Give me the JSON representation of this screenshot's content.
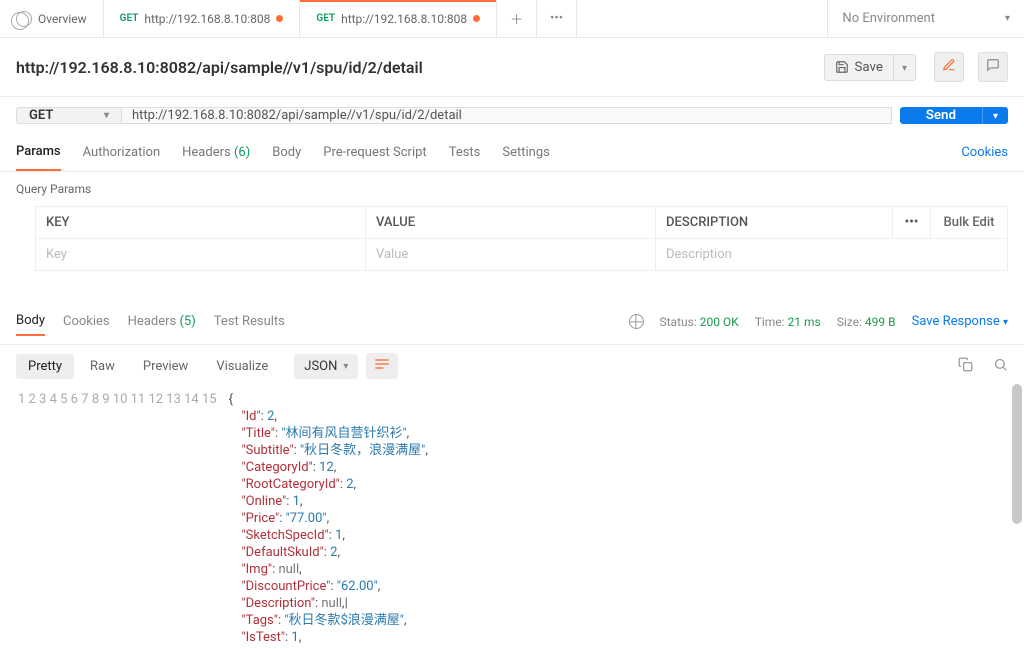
{
  "tabs": [
    {
      "kind": "overview",
      "label": "Overview"
    },
    {
      "kind": "req",
      "method": "GET",
      "label": "http://192.168.8.10:808",
      "dirty": true
    },
    {
      "kind": "req",
      "method": "GET",
      "label": "http://192.168.8.10:808",
      "dirty": true,
      "active": true
    }
  ],
  "env": {
    "label": "No Environment"
  },
  "request": {
    "title": "http://192.168.8.10:8082/api/sample//v1/spu/id/2/detail",
    "method": "GET",
    "url": "http://192.168.8.10:8082/api/sample//v1/spu/id/2/detail",
    "save": "Save",
    "send": "Send"
  },
  "reqtabs": {
    "params": "Params",
    "auth": "Authorization",
    "headers": "Headers",
    "headers_count": "(6)",
    "body": "Body",
    "prereq": "Pre-request Script",
    "tests": "Tests",
    "settings": "Settings",
    "cookies": "Cookies"
  },
  "query_params": {
    "section": "Query Params",
    "h_key": "KEY",
    "h_val": "VALUE",
    "h_desc": "DESCRIPTION",
    "bulk": "Bulk Edit",
    "ph_key": "Key",
    "ph_val": "Value",
    "ph_desc": "Description"
  },
  "resp_tabs": {
    "body": "Body",
    "cookies": "Cookies",
    "headers": "Headers",
    "headers_count": "(5)",
    "tests": "Test Results"
  },
  "status": {
    "status_label": "Status:",
    "status_val": "200 OK",
    "time_label": "Time:",
    "time_val": "21 ms",
    "size_label": "Size:",
    "size_val": "499 B",
    "save": "Save Response"
  },
  "viewbar": {
    "pretty": "Pretty",
    "raw": "Raw",
    "preview": "Preview",
    "visualize": "Visualize",
    "fmt": "JSON"
  },
  "json_lines": [
    [
      {
        "t": "p",
        "v": "{"
      }
    ],
    [
      {
        "t": "sp",
        "v": "    "
      },
      {
        "t": "k",
        "v": "\"Id\""
      },
      {
        "t": "p",
        "v": ": "
      },
      {
        "t": "n",
        "v": "2"
      },
      {
        "t": "p",
        "v": ","
      }
    ],
    [
      {
        "t": "sp",
        "v": "    "
      },
      {
        "t": "k",
        "v": "\"Title\""
      },
      {
        "t": "p",
        "v": ": "
      },
      {
        "t": "s",
        "v": "\"林间有风自营针织衫\""
      },
      {
        "t": "p",
        "v": ","
      }
    ],
    [
      {
        "t": "sp",
        "v": "    "
      },
      {
        "t": "k",
        "v": "\"Subtitle\""
      },
      {
        "t": "p",
        "v": ": "
      },
      {
        "t": "s",
        "v": "\"秋日冬款，浪漫满屋\""
      },
      {
        "t": "p",
        "v": ","
      }
    ],
    [
      {
        "t": "sp",
        "v": "    "
      },
      {
        "t": "k",
        "v": "\"CategoryId\""
      },
      {
        "t": "p",
        "v": ": "
      },
      {
        "t": "n",
        "v": "12"
      },
      {
        "t": "p",
        "v": ","
      }
    ],
    [
      {
        "t": "sp",
        "v": "    "
      },
      {
        "t": "k",
        "v": "\"RootCategoryId\""
      },
      {
        "t": "p",
        "v": ": "
      },
      {
        "t": "n",
        "v": "2"
      },
      {
        "t": "p",
        "v": ","
      }
    ],
    [
      {
        "t": "sp",
        "v": "    "
      },
      {
        "t": "k",
        "v": "\"Online\""
      },
      {
        "t": "p",
        "v": ": "
      },
      {
        "t": "n",
        "v": "1"
      },
      {
        "t": "p",
        "v": ","
      }
    ],
    [
      {
        "t": "sp",
        "v": "    "
      },
      {
        "t": "k",
        "v": "\"Price\""
      },
      {
        "t": "p",
        "v": ": "
      },
      {
        "t": "s",
        "v": "\"77.00\""
      },
      {
        "t": "p",
        "v": ","
      }
    ],
    [
      {
        "t": "sp",
        "v": "    "
      },
      {
        "t": "k",
        "v": "\"SketchSpecId\""
      },
      {
        "t": "p",
        "v": ": "
      },
      {
        "t": "n",
        "v": "1"
      },
      {
        "t": "p",
        "v": ","
      }
    ],
    [
      {
        "t": "sp",
        "v": "    "
      },
      {
        "t": "k",
        "v": "\"DefaultSkuId\""
      },
      {
        "t": "p",
        "v": ": "
      },
      {
        "t": "n",
        "v": "2"
      },
      {
        "t": "p",
        "v": ","
      }
    ],
    [
      {
        "t": "sp",
        "v": "    "
      },
      {
        "t": "k",
        "v": "\"Img\""
      },
      {
        "t": "p",
        "v": ": "
      },
      {
        "t": "nl",
        "v": "null"
      },
      {
        "t": "p",
        "v": ","
      }
    ],
    [
      {
        "t": "sp",
        "v": "    "
      },
      {
        "t": "k",
        "v": "\"DiscountPrice\""
      },
      {
        "t": "p",
        "v": ": "
      },
      {
        "t": "s",
        "v": "\"62.00\""
      },
      {
        "t": "p",
        "v": ","
      }
    ],
    [
      {
        "t": "sp",
        "v": "    "
      },
      {
        "t": "k",
        "v": "\"Description\""
      },
      {
        "t": "p",
        "v": ": "
      },
      {
        "t": "nl",
        "v": "null"
      },
      {
        "t": "p",
        "v": ",|"
      }
    ],
    [
      {
        "t": "sp",
        "v": "    "
      },
      {
        "t": "k",
        "v": "\"Tags\""
      },
      {
        "t": "p",
        "v": ": "
      },
      {
        "t": "s",
        "v": "\"秋日冬款$浪漫满屋\""
      },
      {
        "t": "p",
        "v": ","
      }
    ],
    [
      {
        "t": "sp",
        "v": "    "
      },
      {
        "t": "k",
        "v": "\"IsTest\""
      },
      {
        "t": "p",
        "v": ": "
      },
      {
        "t": "n",
        "v": "1"
      },
      {
        "t": "p",
        "v": ","
      }
    ]
  ]
}
